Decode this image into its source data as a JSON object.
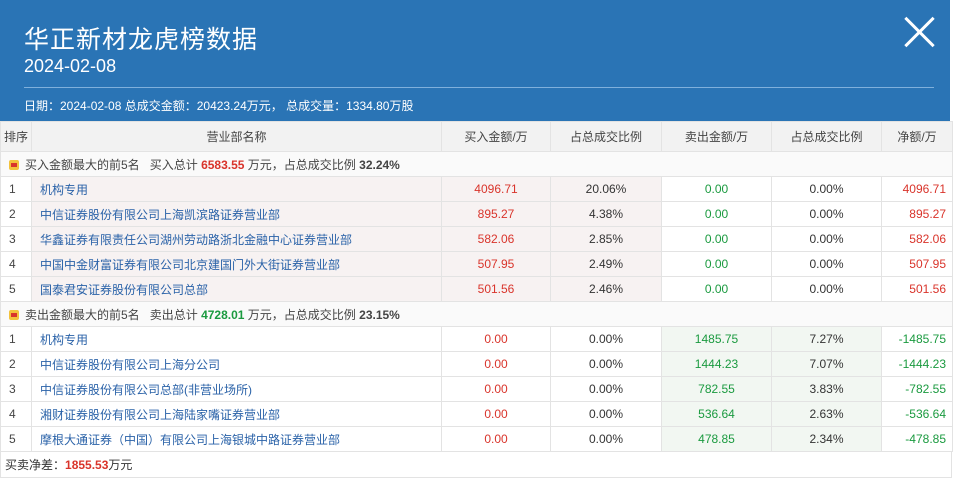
{
  "header": {
    "title": "华正新材龙虎榜数据",
    "date": "2024-02-08",
    "summary": "日期：2024-02-08 总成交金额：20423.24万元， 总成交量：1334.80万股"
  },
  "table": {
    "columns": [
      "排序",
      "营业部名称",
      "买入金额/万",
      "占总成交比例",
      "卖出金额/万",
      "占总成交比例",
      "净额/万"
    ],
    "buy_group": {
      "label": "买入金额最大的前5名",
      "total_label": "买入总计",
      "total_value": "6583.55",
      "unit_text": "万元，占总成交比例",
      "ratio": "32.24%"
    },
    "buy_rows": [
      {
        "idx": "1",
        "name": "机构专用",
        "buy": "4096.71",
        "buy_pct": "20.06%",
        "sell": "0.00",
        "sell_pct": "0.00%",
        "net": "4096.71"
      },
      {
        "idx": "2",
        "name": "中信证券股份有限公司上海凯滨路证券营业部",
        "buy": "895.27",
        "buy_pct": "4.38%",
        "sell": "0.00",
        "sell_pct": "0.00%",
        "net": "895.27"
      },
      {
        "idx": "3",
        "name": "华鑫证券有限责任公司湖州劳动路浙北金融中心证券营业部",
        "buy": "582.06",
        "buy_pct": "2.85%",
        "sell": "0.00",
        "sell_pct": "0.00%",
        "net": "582.06"
      },
      {
        "idx": "4",
        "name": "中国中金财富证券有限公司北京建国门外大街证券营业部",
        "buy": "507.95",
        "buy_pct": "2.49%",
        "sell": "0.00",
        "sell_pct": "0.00%",
        "net": "507.95"
      },
      {
        "idx": "5",
        "name": "国泰君安证券股份有限公司总部",
        "buy": "501.56",
        "buy_pct": "2.46%",
        "sell": "0.00",
        "sell_pct": "0.00%",
        "net": "501.56"
      }
    ],
    "sell_group": {
      "label": "卖出金额最大的前5名",
      "total_label": "卖出总计",
      "total_value": "4728.01",
      "unit_text": "万元，占总成交比例",
      "ratio": "23.15%"
    },
    "sell_rows": [
      {
        "idx": "1",
        "name": "机构专用",
        "buy": "0.00",
        "buy_pct": "0.00%",
        "sell": "1485.75",
        "sell_pct": "7.27%",
        "net": "-1485.75"
      },
      {
        "idx": "2",
        "name": "中信证券股份有限公司上海分公司",
        "buy": "0.00",
        "buy_pct": "0.00%",
        "sell": "1444.23",
        "sell_pct": "7.07%",
        "net": "-1444.23"
      },
      {
        "idx": "3",
        "name": "中信证券股份有限公司总部(非营业场所)",
        "buy": "0.00",
        "buy_pct": "0.00%",
        "sell": "782.55",
        "sell_pct": "3.83%",
        "net": "-782.55"
      },
      {
        "idx": "4",
        "name": "湘财证券股份有限公司上海陆家嘴证券营业部",
        "buy": "0.00",
        "buy_pct": "0.00%",
        "sell": "536.64",
        "sell_pct": "2.63%",
        "net": "-536.64"
      },
      {
        "idx": "5",
        "name": "摩根大通证券（中国）有限公司上海银城中路证券营业部",
        "buy": "0.00",
        "buy_pct": "0.00%",
        "sell": "478.85",
        "sell_pct": "2.34%",
        "net": "-478.85"
      }
    ]
  },
  "footer": {
    "label": "买卖净差：",
    "value": "1855.53",
    "unit": "万元"
  },
  "colors": {
    "header_bg": "#2a74b5",
    "positive": "#d9342b",
    "negative": "#1a9a3f",
    "link": "#2a62a8"
  }
}
